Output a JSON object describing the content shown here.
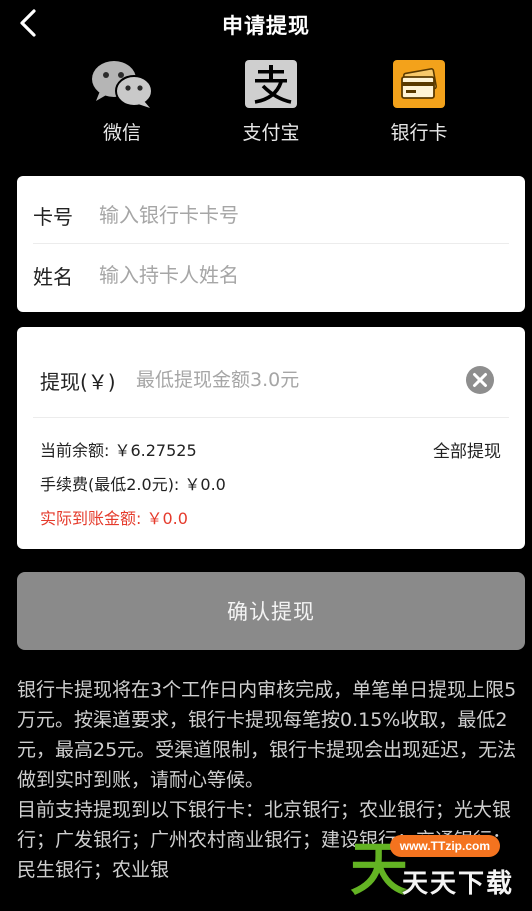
{
  "header": {
    "title": "申请提现",
    "back_icon": "chevron-left-icon"
  },
  "methods": [
    {
      "label": "微信",
      "icon": "wechat-icon",
      "color": "#b7b7b7"
    },
    {
      "label": "支付宝",
      "icon": "alipay-icon",
      "color": "#cfcfcf"
    },
    {
      "label": "银行卡",
      "icon": "bank-card-icon",
      "color": "#f3a21b"
    }
  ],
  "card_form": {
    "card_number_label": "卡号",
    "card_number_placeholder": "输入银行卡卡号",
    "name_label": "姓名",
    "name_placeholder": "输入持卡人姓名"
  },
  "amount_form": {
    "amount_label": "提现(￥)",
    "amount_placeholder": "最低提现金额3.0元",
    "balance_text": "当前余额: ￥6.27525",
    "withdraw_all_label": "全部提现",
    "fee_text": "手续费(最低2.0元): ￥0.0",
    "actual_text": "实际到账金额: ￥0.0",
    "accent_color": "#e53b2c"
  },
  "confirm_label": "确认提现",
  "notes": [
    "银行卡提现将在3个工作日内审核完成，单笔单日提现上限5万元。按渠道要求，银行卡提现每笔按0.15%收取，最低2元，最高25元。受渠道限制，银行卡提现会出现延迟，无法做到实时到账，请耐心等候。",
    "目前支持提现到以下银行卡：北京银行；农业银行；光大银行；广发银行；广州农村商业银行；建设银行；交通银行；民生银行；农业银"
  ],
  "watermark": {
    "url": "www.TTzip.com",
    "text": "天天下载",
    "logo": "天"
  }
}
